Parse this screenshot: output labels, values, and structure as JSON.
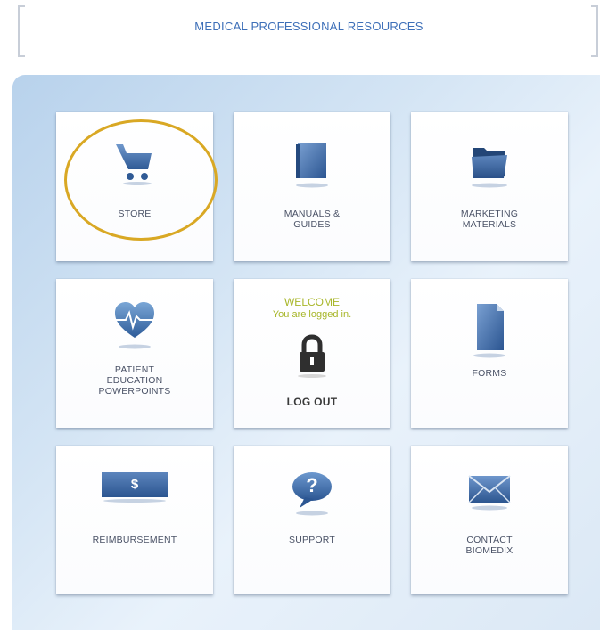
{
  "header": {
    "title": "MEDICAL PROFESSIONAL RESOURCES"
  },
  "tiles": {
    "store": {
      "label": "STORE",
      "icon": "cart-icon"
    },
    "manuals": {
      "line1": "MANUALS &",
      "line2": "GUIDES",
      "icon": "book-icon"
    },
    "marketing": {
      "line1": "MARKETING",
      "line2": "MATERIALS",
      "icon": "folder-icon"
    },
    "patient_education": {
      "line1": "PATIENT",
      "line2": "EDUCATION",
      "line3": "POWERPOINTS",
      "icon": "heart-pulse-icon"
    },
    "account": {
      "welcome": "WELCOME",
      "status": "You are logged in.",
      "label": "LOG OUT",
      "icon": "lock-icon"
    },
    "forms": {
      "label": "FORMS",
      "icon": "document-icon"
    },
    "reimbursement": {
      "label": "REIMBURSEMENT",
      "icon_text": "$",
      "icon": "dollar-bill-icon"
    },
    "support": {
      "label": "SUPPORT",
      "icon_text": "?",
      "icon": "question-bubble-icon"
    },
    "contact": {
      "line1": "CONTACT",
      "line2": "BIOMEDIX",
      "icon": "envelope-icon"
    }
  },
  "colors": {
    "title": "#3d6fb8",
    "icon_blue": "#3e6ba6",
    "welcome": "#a8b62a",
    "highlight": "#d9a824",
    "panel": "#cfe1f3"
  }
}
